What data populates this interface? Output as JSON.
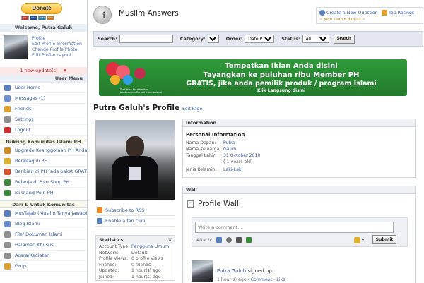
{
  "sidebar": {
    "donate_label": "Donate",
    "cards": [
      "MC",
      "VISA",
      "AMEX",
      "DISC"
    ],
    "welcome": "Welcome, Putra Galuh",
    "profile_links": [
      "Profile",
      "Edit Profile Information",
      "Change Profile Photo",
      "Edit Profile Layout"
    ],
    "update_text": "1 new update(s)",
    "update_close": "X",
    "user_menu_title": "User Menu",
    "user_menu": [
      {
        "label": "User Home",
        "icon": "home-icon",
        "color": "#5a7fc0"
      },
      {
        "label": "Messages (1)",
        "icon": "messages-icon",
        "color": "#6a8fd0"
      },
      {
        "label": "Friends",
        "icon": "friends-icon",
        "color": "#e0a030"
      },
      {
        "label": "Settings",
        "icon": "settings-icon",
        "color": "#909090"
      },
      {
        "label": "Logout",
        "icon": "logout-icon",
        "color": "#d03030"
      }
    ],
    "section1_title": "Dukung Komunitas Islami PH",
    "section1_items": [
      {
        "label": "Upgrade Keanggotaan PH Anda",
        "icon": "upgrade-icon",
        "color": "#d08a20"
      },
      {
        "label": "Berinfaq di PH",
        "icon": "donation-icon",
        "color": "#e0b030"
      },
      {
        "label": "Berikian di PH (ada paket GRATIS)",
        "icon": "ad-icon",
        "color": "#d05030"
      },
      {
        "label": "Belanja di Poin Shop PH",
        "icon": "shop-icon",
        "color": "#3a8a3a"
      },
      {
        "label": "Isi Ulang Poin PH",
        "icon": "points-icon",
        "color": "#3a8a3a"
      }
    ],
    "section2_title": "Dari & Untuk Komunitas",
    "section2_items": [
      {
        "label": "MusTaJab (Muslim Tanya Jawab)",
        "icon": "qa-icon",
        "color": "#5a7fc0"
      },
      {
        "label": "Blog Islami",
        "icon": "blog-icon",
        "color": "#6a8fd0"
      },
      {
        "label": "File/ Dokumen Islami",
        "icon": "file-icon",
        "color": "#909090"
      },
      {
        "label": "Halaman Khusus",
        "icon": "page-icon",
        "color": "#909090"
      },
      {
        "label": "Acara/Kegiatan",
        "icon": "calendar-icon",
        "color": "#909090"
      },
      {
        "label": "Grup",
        "icon": "group-icon",
        "color": "#e0a030"
      }
    ]
  },
  "header": {
    "site_title": "Muslim Answers",
    "create_question": "Create a New Question",
    "top_ratings": "Top Ratings",
    "search_hint": "~ Mhn search dahulu ~"
  },
  "search": {
    "search_label": "Search:",
    "category_label": "Category:",
    "order_label": "Order:",
    "order_value": "Date Posted",
    "status_label": "Status:",
    "status_value": "All",
    "button": "Search"
  },
  "banner": {
    "line1": "Tempatkan Iklan Anda disini",
    "line2": "Tayangkan ke puluhan ribu Member PH",
    "line3": "GRATIS, jika anda pemilik produk / program Islami",
    "line4": "Klik Langsung disini",
    "tiny": "Tarif Iklan PH diberikan berdasarkan Rumah Internasional"
  },
  "profile": {
    "title": "Putra Galuh's Profile",
    "edit_link": "Edit Page",
    "rss": "Subscribe to RSS",
    "fan": "Enable a fan club"
  },
  "stats": {
    "title": "Statistics",
    "close": "X",
    "rows": [
      {
        "k": "Account Type:",
        "v": "Pengguna Umum",
        "link": true
      },
      {
        "k": "Network:",
        "v": "Default",
        "link": false
      },
      {
        "k": "Profile Views:",
        "v": "0 profile views",
        "link": false
      },
      {
        "k": "Friends:",
        "v": "0 friends",
        "link": false
      },
      {
        "k": "Updated:",
        "v": "1 hour(s) ago",
        "link": false
      },
      {
        "k": "Joined:",
        "v": "1 hour(s) ago",
        "link": false
      }
    ]
  },
  "info": {
    "title": "Information",
    "subtitle": "Personal Information",
    "rows": [
      {
        "k": "Nama Depan:",
        "v": "Putra"
      },
      {
        "k": "Nama Keluarga:",
        "v": "Galuh"
      },
      {
        "k": "Tanggal Lahir:",
        "v": "31 October 2010"
      },
      {
        "k": "",
        "v": "(-1 years old)"
      },
      {
        "k": "Jenis Kelamin:",
        "v": "Laki-Laki"
      }
    ]
  },
  "wall": {
    "section_title": "Wall",
    "title": "Profile Wall",
    "placeholder": "Write a comment...",
    "attach_label": "Attach:",
    "submit": "Submit",
    "feed_name": "Putra Galuh",
    "feed_action": "signed up.",
    "feed_time": "1 hour(s) ago",
    "feed_comment": "Comment",
    "feed_like": "Like",
    "feed_sep": " - "
  }
}
